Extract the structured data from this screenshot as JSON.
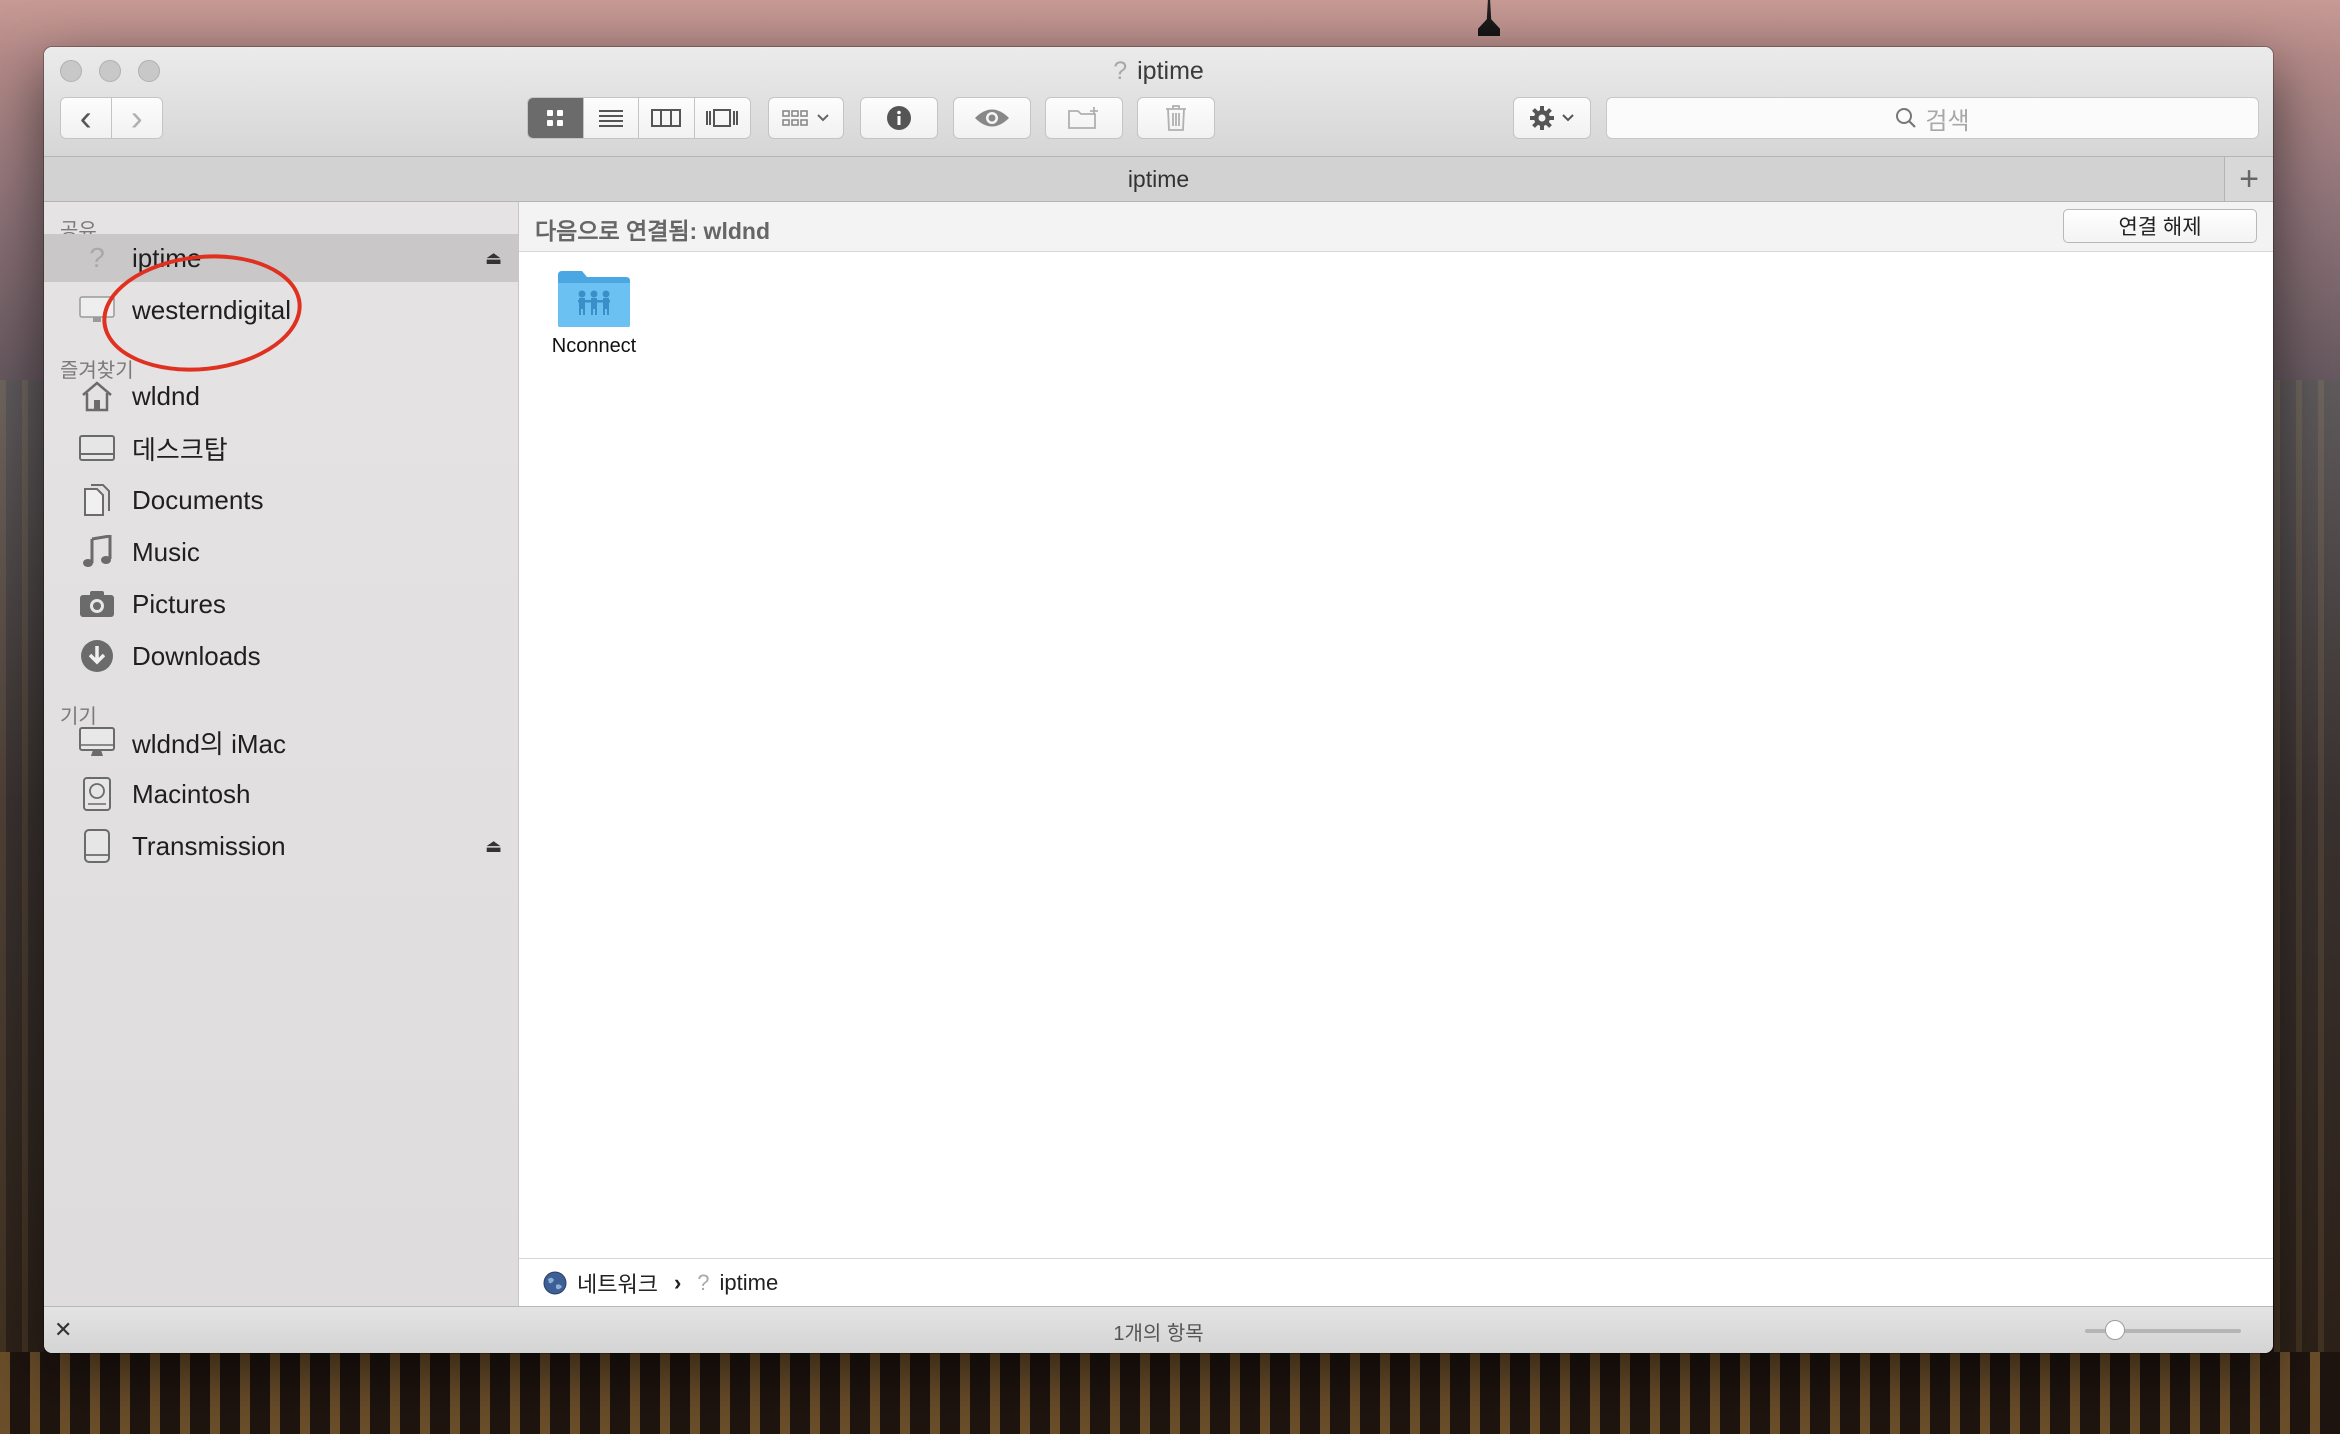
{
  "window": {
    "title": "iptime",
    "title_icon": "?"
  },
  "toolbar": {
    "back_icon": "‹",
    "forward_icon": "›",
    "search_placeholder": "검색"
  },
  "tab": {
    "label": "iptime",
    "add_label": "+"
  },
  "sidebar": {
    "sections": {
      "shared": "공유",
      "favorites": "즐겨찾기",
      "devices": "기기"
    },
    "shared_items": [
      {
        "label": "iptime",
        "icon": "question-server-icon",
        "selected": true,
        "ejectable": true
      },
      {
        "label": "westerndigital",
        "icon": "monitor-icon",
        "selected": false,
        "ejectable": false
      }
    ],
    "favorite_items": [
      {
        "label": "wldnd",
        "icon": "home-icon"
      },
      {
        "label": "데스크탑",
        "icon": "desktop-icon"
      },
      {
        "label": "Documents",
        "icon": "documents-icon"
      },
      {
        "label": "Music",
        "icon": "music-icon"
      },
      {
        "label": "Pictures",
        "icon": "camera-icon"
      },
      {
        "label": "Downloads",
        "icon": "download-icon"
      }
    ],
    "device_items": [
      {
        "label": "wldnd의 iMac",
        "icon": "imac-icon",
        "ejectable": false
      },
      {
        "label": "Macintosh",
        "icon": "hard-drive-icon",
        "ejectable": false
      },
      {
        "label": "Transmission",
        "icon": "external-drive-icon",
        "ejectable": true
      }
    ],
    "eject_glyph": "⏏"
  },
  "main": {
    "connected_as": "다음으로 연결됨: wldnd",
    "disconnect_label": "연결 해제",
    "files": [
      {
        "name": "Nconnect",
        "icon": "shared-folder-icon"
      }
    ]
  },
  "pathbar": {
    "network_label": "네트워크",
    "separator": "›",
    "current_label": "iptime"
  },
  "statusbar": {
    "item_count": "1개의 항목",
    "icon_size_fraction": 0.15
  },
  "colors": {
    "annotation_circle": "#e03020",
    "folder_blue": "#5ab4ec",
    "selected_row": "#c9c7c8"
  }
}
